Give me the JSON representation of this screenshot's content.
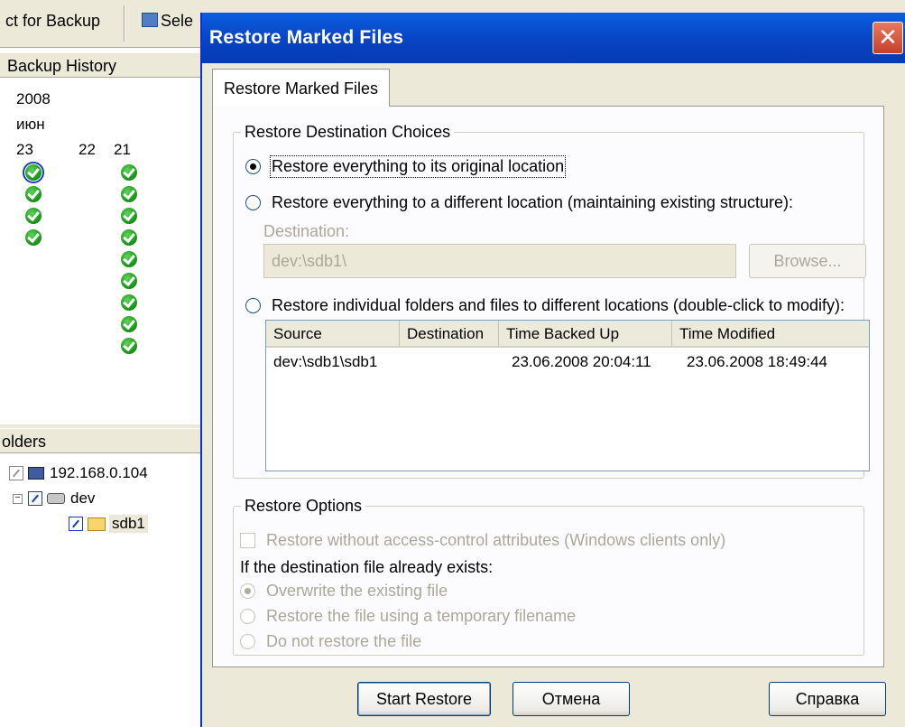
{
  "toolbar": {
    "mark_for_backup": "ct for Backup",
    "select_partial": "Sele"
  },
  "left_pane": {
    "history_header": "Backup History",
    "year": "2008",
    "month": "июн",
    "days": [
      "23",
      "22",
      "21"
    ],
    "folders_header": "olders",
    "tree": {
      "host": "192.168.0.104",
      "drive": "dev",
      "folder": "sdb1"
    }
  },
  "dialog": {
    "title": "Restore Marked Files",
    "close_glyph": "✕",
    "tab_label": "Restore Marked Files",
    "destination_group": {
      "legend": "Restore Destination Choices",
      "options": [
        {
          "label": "Restore everything to its original location",
          "selected": true
        },
        {
          "label": "Restore everything to a different location (maintaining existing structure):",
          "selected": false
        },
        {
          "label": "Restore individual folders and files to different locations (double-click to modify):",
          "selected": false
        }
      ],
      "destination_label": "Destination:",
      "destination_value": "dev:\\sdb1\\",
      "browse_label": "Browse..."
    },
    "files_table": {
      "columns": [
        "Source",
        "Destination",
        "Time Backed Up",
        "Time Modified"
      ],
      "rows": [
        {
          "source": "dev:\\sdb1\\sdb1",
          "destination": "",
          "time_backed_up": "23.06.2008 20:04:11",
          "time_modified": "23.06.2008 18:49:44"
        }
      ]
    },
    "options_group": {
      "legend": "Restore Options",
      "acl_checkbox": "Restore without access-control attributes (Windows clients only)",
      "exists_label": "If the destination file already exists:",
      "exists_options": [
        {
          "label": "Overwrite the existing file",
          "selected": true
        },
        {
          "label": "Restore the file using a temporary filename",
          "selected": false
        },
        {
          "label": "Do not restore the file",
          "selected": false
        }
      ]
    },
    "buttons": {
      "start": "Start Restore",
      "cancel": "Отмена",
      "help": "Справка"
    }
  },
  "colors": {
    "titlebar": "#0845c6",
    "dialog_bg": "#ece9d8",
    "check_green": "#1d9a1d"
  }
}
